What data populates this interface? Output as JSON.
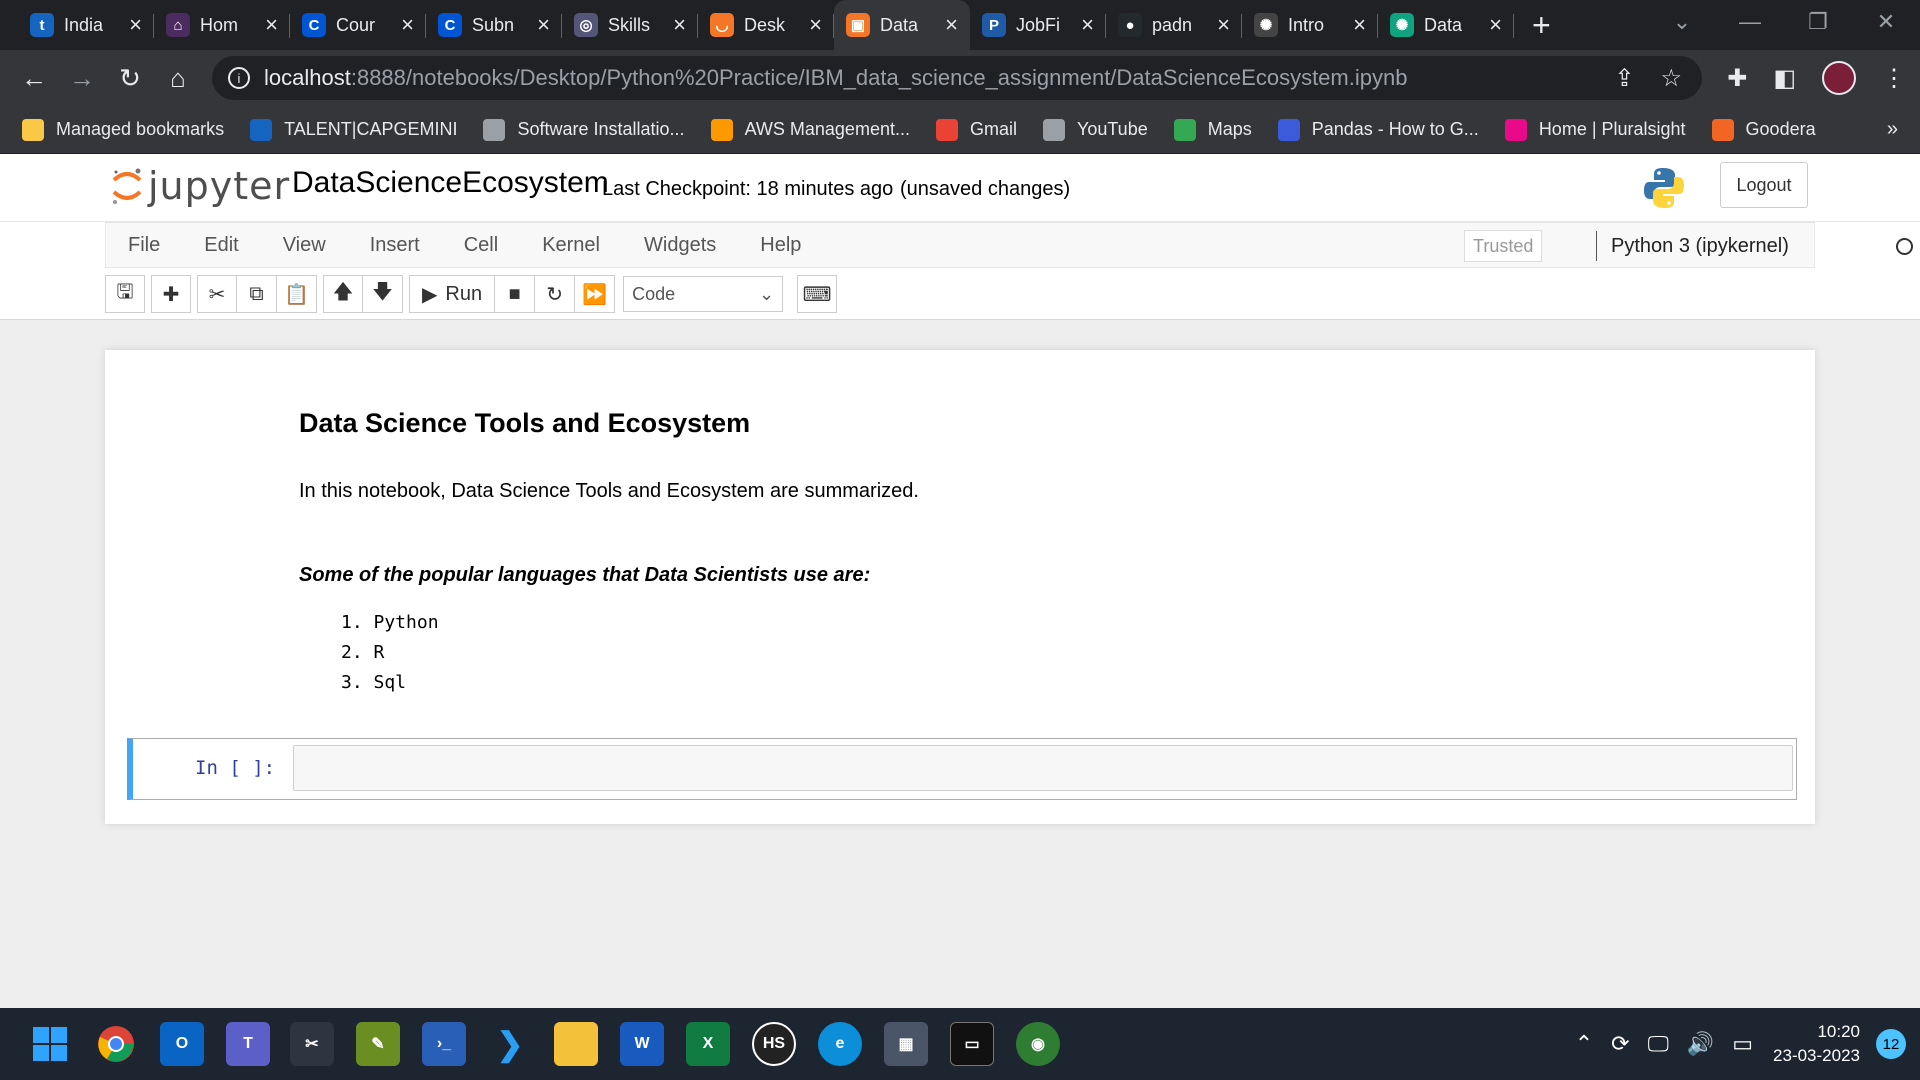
{
  "browser": {
    "tabs": [
      {
        "title": "India",
        "icon": "t-icon",
        "color": "#1565c0",
        "glyph": "t"
      },
      {
        "title": "Hom",
        "icon": "home-icon",
        "color": "#4a2c5e",
        "glyph": "⌂"
      },
      {
        "title": "Cour",
        "icon": "coursera-icon",
        "color": "#0056d2",
        "glyph": "C"
      },
      {
        "title": "Subn",
        "icon": "coursera-icon",
        "color": "#0056d2",
        "glyph": "C"
      },
      {
        "title": "Skills",
        "icon": "skills-icon",
        "color": "#555577",
        "glyph": "◎"
      },
      {
        "title": "Desk",
        "icon": "jupyter-icon",
        "color": "#f37726",
        "glyph": "◡"
      },
      {
        "title": "Data",
        "icon": "notebook-icon",
        "color": "#f37726",
        "glyph": "▣",
        "active": true
      },
      {
        "title": "JobFi",
        "icon": "pega-icon",
        "color": "#1f5aa6",
        "glyph": "P"
      },
      {
        "title": "padn",
        "icon": "github-icon",
        "color": "#24292e",
        "glyph": "●"
      },
      {
        "title": "Intro",
        "icon": "openai-icon",
        "color": "#444444",
        "glyph": "✺"
      },
      {
        "title": "Data",
        "icon": "openai-icon",
        "color": "#10a37f",
        "glyph": "✺"
      }
    ],
    "new_tab": "+",
    "url_host": "localhost",
    "url_path": ":8888/notebooks/Desktop/Python%20Practice/IBM_data_science_assignment/DataScienceEcosystem.ipynb",
    "bookmarks": [
      {
        "label": "Managed bookmarks",
        "icon": "folder-icon",
        "color": "#f9c846"
      },
      {
        "label": "TALENT|CAPGEMINI",
        "icon": "t-icon",
        "color": "#1565c0"
      },
      {
        "label": "Software Installatio...",
        "icon": "software-icon",
        "color": "#9aa0a6"
      },
      {
        "label": "AWS Management...",
        "icon": "aws-icon",
        "color": "#ff9900"
      },
      {
        "label": "Gmail",
        "icon": "gmail-icon",
        "color": "#ea4335"
      },
      {
        "label": "YouTube",
        "icon": "globe-icon",
        "color": "#9aa0a6"
      },
      {
        "label": "Maps",
        "icon": "maps-icon",
        "color": "#34a853"
      },
      {
        "label": "Pandas - How to G...",
        "icon": "pandas-icon",
        "color": "#3b5bdb"
      },
      {
        "label": "Home | Pluralsight",
        "icon": "pluralsight-icon",
        "color": "#e80a89"
      },
      {
        "label": "Goodera",
        "icon": "goodera-icon",
        "color": "#f26522"
      }
    ],
    "more": "»"
  },
  "jupyter": {
    "logo_text": "jupyter",
    "notebook_name": "DataScienceEcosystem",
    "checkpoint": "Last Checkpoint: 18 minutes ago",
    "unsaved": "(unsaved changes)",
    "logout": "Logout",
    "menus": [
      "File",
      "Edit",
      "View",
      "Insert",
      "Cell",
      "Kernel",
      "Widgets",
      "Help"
    ],
    "trusted": "Trusted",
    "kernel": "Python 3 (ipykernel)",
    "run_label": "Run",
    "cell_type": "Code"
  },
  "notebook": {
    "heading": "Data Science Tools and Ecosystem",
    "intro": "In this notebook, Data Science Tools and Ecosystem are summarized.",
    "languages_title": "Some of the popular languages that Data Scientists use are:",
    "languages": [
      "1. Python",
      "2. R",
      "3. Sql"
    ],
    "prompt": "In [ ]:"
  },
  "taskbar": {
    "time": "10:20",
    "date": "23-03-2023",
    "notifications": "12"
  },
  "colors": {
    "accent_cell": "#42a5f5",
    "jupyter_orange": "#f37726",
    "chrome_dark": "#202124"
  }
}
